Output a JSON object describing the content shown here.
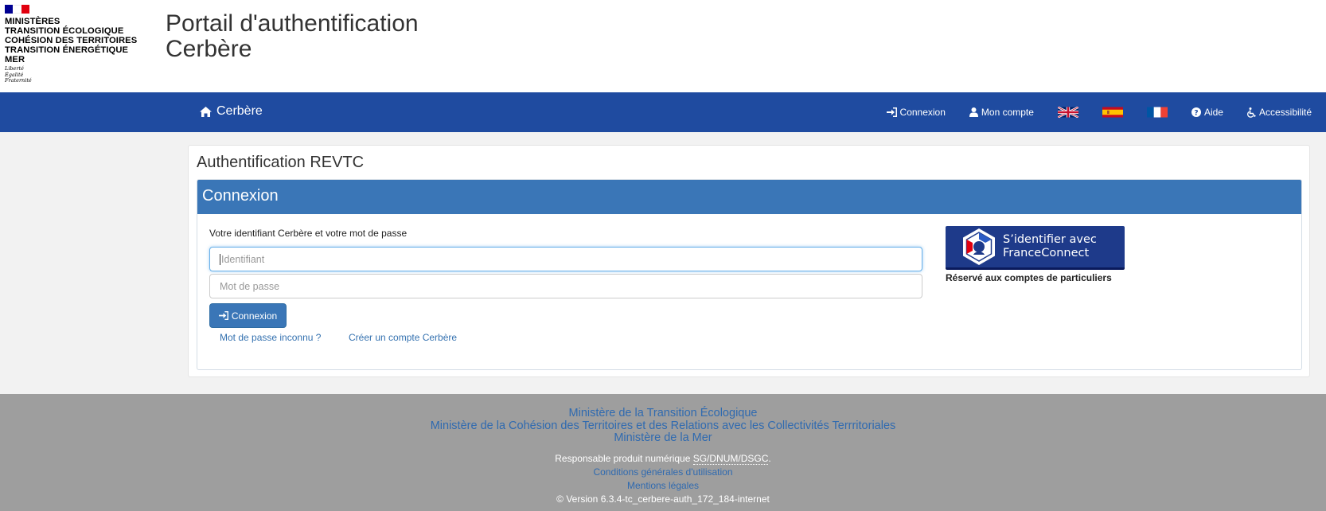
{
  "brand": {
    "ministries": [
      "MINISTÈRES",
      "TRANSITION ÉCOLOGIQUE",
      "COHÉSION DES TERRITOIRES",
      "TRANSITION ÉNERGÉTIQUE",
      "MER"
    ],
    "devise": [
      "Liberté",
      "Égalité",
      "Fraternité"
    ],
    "flag_colors": [
      "#000091",
      "#ffffff",
      "#e1000f"
    ]
  },
  "header": {
    "title_line1": "Portail d'authentification",
    "title_line2": "Cerbère"
  },
  "navbar": {
    "home_label": "Cerbère",
    "home_icon": "home-icon",
    "login_label": "Connexion",
    "account_label": "Mon compte",
    "languages": [
      "en",
      "es",
      "fr"
    ],
    "help_label": "Aide",
    "accessibility_label": "Accessibilité",
    "bg_color": "#1f4ba0"
  },
  "main": {
    "panel_title": "Authentification REVTC",
    "section_title": "Connexion",
    "instructions": "Votre identifiant Cerbère et votre mot de passe",
    "identifier_placeholder": "Identifiant",
    "password_placeholder": "Mot de passe",
    "submit_label": "Connexion",
    "forgot_link": "Mot de passe inconnu ?",
    "create_link": "Créer un compte Cerbère",
    "accent_color": "#3a76b7"
  },
  "franceconnect": {
    "line1": "S’identifier avec",
    "line2": "FranceConnect",
    "note": "Réservé aux comptes de particuliers"
  },
  "footer": {
    "ministries": [
      "Ministère de la Transition Écologique",
      "Ministère de la Cohésion des Territoires et des Relations avec les Collectivités Terrritoriales",
      "Ministère de la Mer"
    ],
    "responsible_prefix": "Responsable produit numérique",
    "responsible_abbr": "SG/DNUM/DSGC",
    "cgu_link": "Conditions générales d'utilisation",
    "legal_link": "Mentions légales",
    "version": "© Version 6.3.4-tc_cerbere-auth_172_184-internet",
    "bg_color": "#9e9e9e"
  }
}
